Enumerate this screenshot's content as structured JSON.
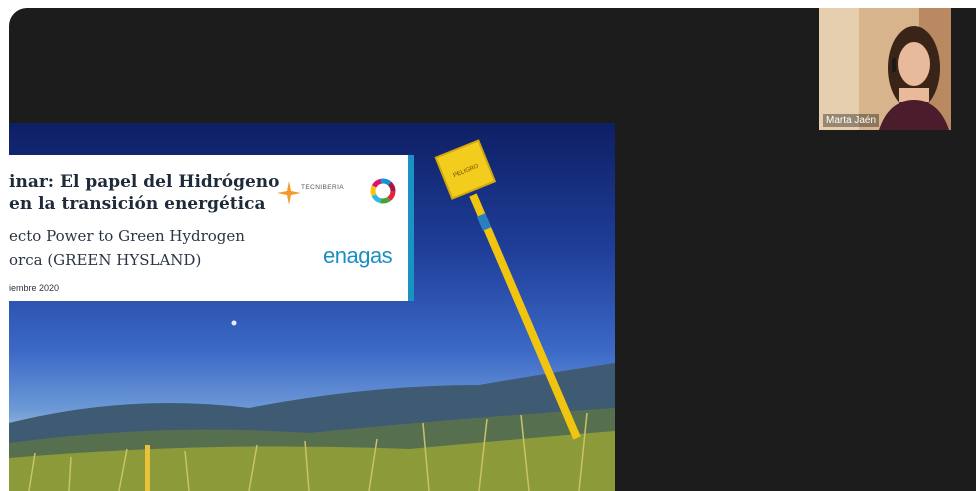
{
  "slide": {
    "title_line1": "inar: El papel del Hidrógeno",
    "title_line2": "en la transición energética",
    "subtitle_line1": "ecto Power to Green Hydrogen",
    "subtitle_line2": "orca (GREEN HYSLAND)",
    "date": "iembre 2020",
    "logos": {
      "tecniberia": "TECNIBERIA",
      "enagas": "enagas"
    },
    "sign_text": "PELIGRO"
  },
  "participant": {
    "name": "Marta Jaén"
  },
  "colors": {
    "app_bg": "#1c1c1c",
    "accent_blue": "#1a92c2",
    "marker_yellow": "#f1c40f"
  }
}
